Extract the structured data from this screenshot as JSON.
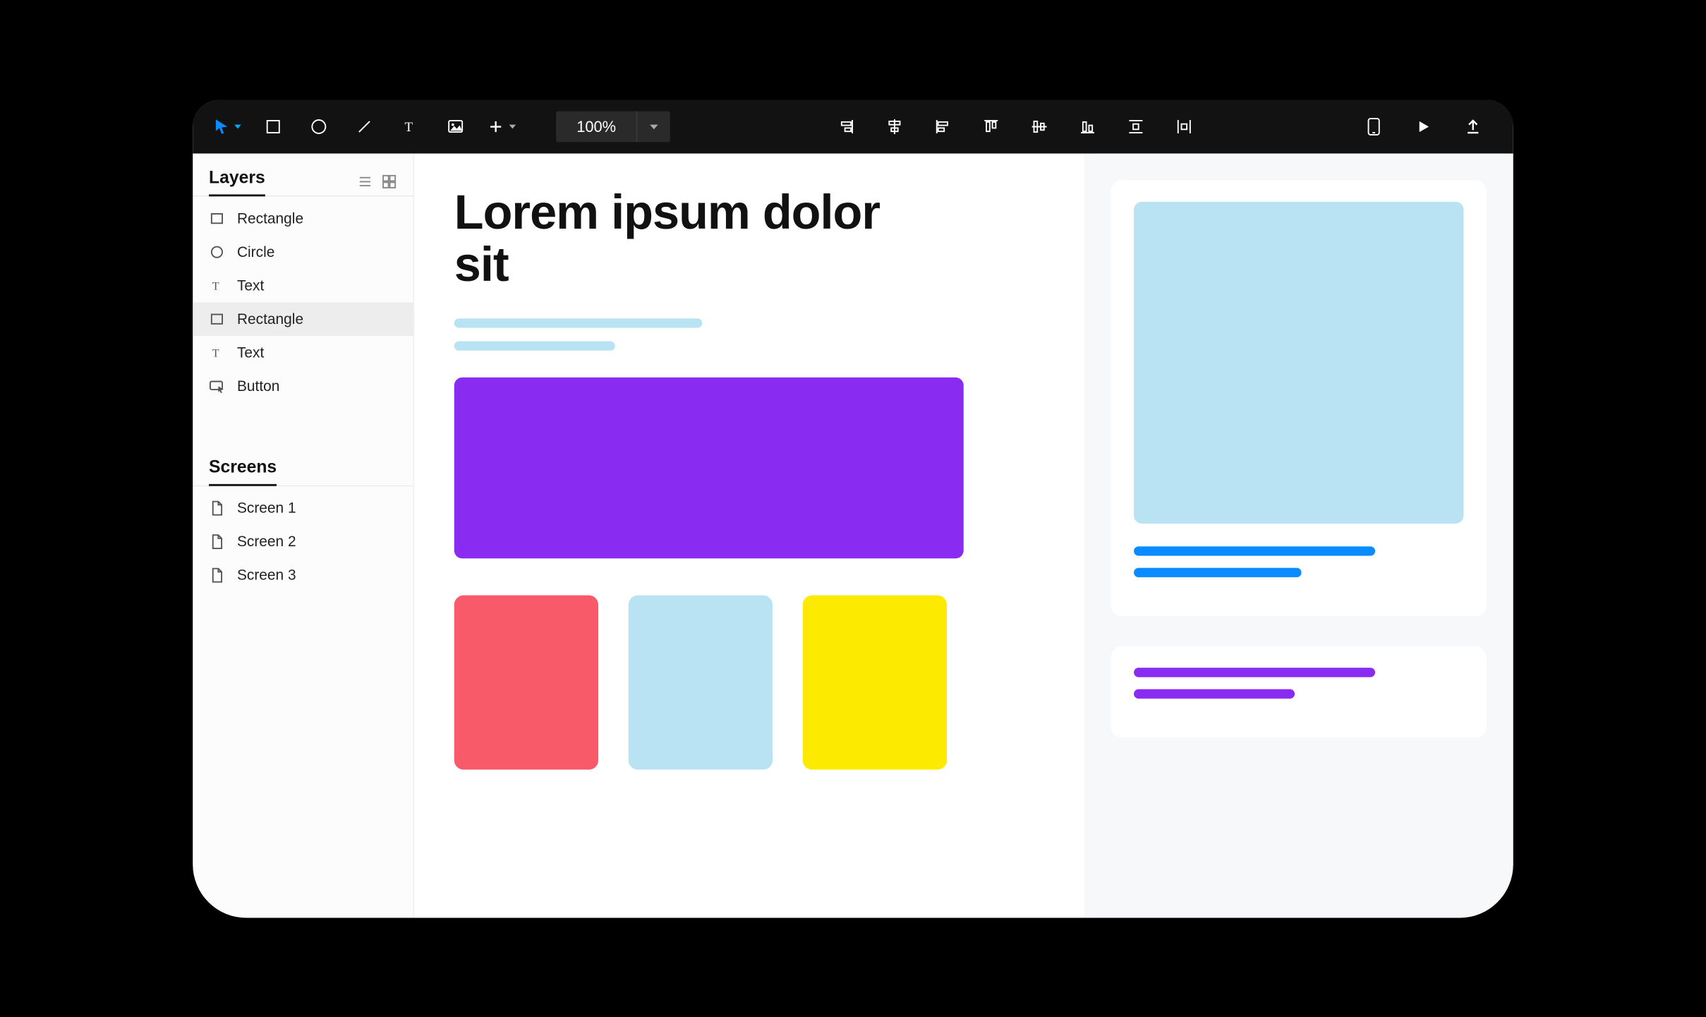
{
  "toolbar": {
    "zoom_label": "100%"
  },
  "sidebar": {
    "layers_title": "Layers",
    "screens_title": "Screens",
    "layers": [
      {
        "label": "Rectangle",
        "icon": "rect",
        "selected": false
      },
      {
        "label": "Circle",
        "icon": "circle",
        "selected": false
      },
      {
        "label": "Text",
        "icon": "text",
        "selected": false
      },
      {
        "label": "Rectangle",
        "icon": "rect",
        "selected": true
      },
      {
        "label": "Text",
        "icon": "text",
        "selected": false
      },
      {
        "label": "Button",
        "icon": "button",
        "selected": false
      }
    ],
    "screens": [
      {
        "label": "Screen 1"
      },
      {
        "label": "Screen 2"
      },
      {
        "label": "Screen 3"
      }
    ]
  },
  "canvas": {
    "headline": "Lorem ipsum dolor sit",
    "big_rect_color": "#8a2bf2",
    "cards": [
      {
        "color": "#f85a6a"
      },
      {
        "color": "#b9e3f2"
      },
      {
        "color": "#fcea00"
      }
    ]
  },
  "rightcol": {
    "panel1": {
      "square_color": "#b9e3f2",
      "line_color": "#0a8bff",
      "line1_w": 360,
      "line2_w": 250
    },
    "panel2": {
      "line_color": "#8a2bf2",
      "line1_w": 360,
      "line2_w": 240
    }
  }
}
